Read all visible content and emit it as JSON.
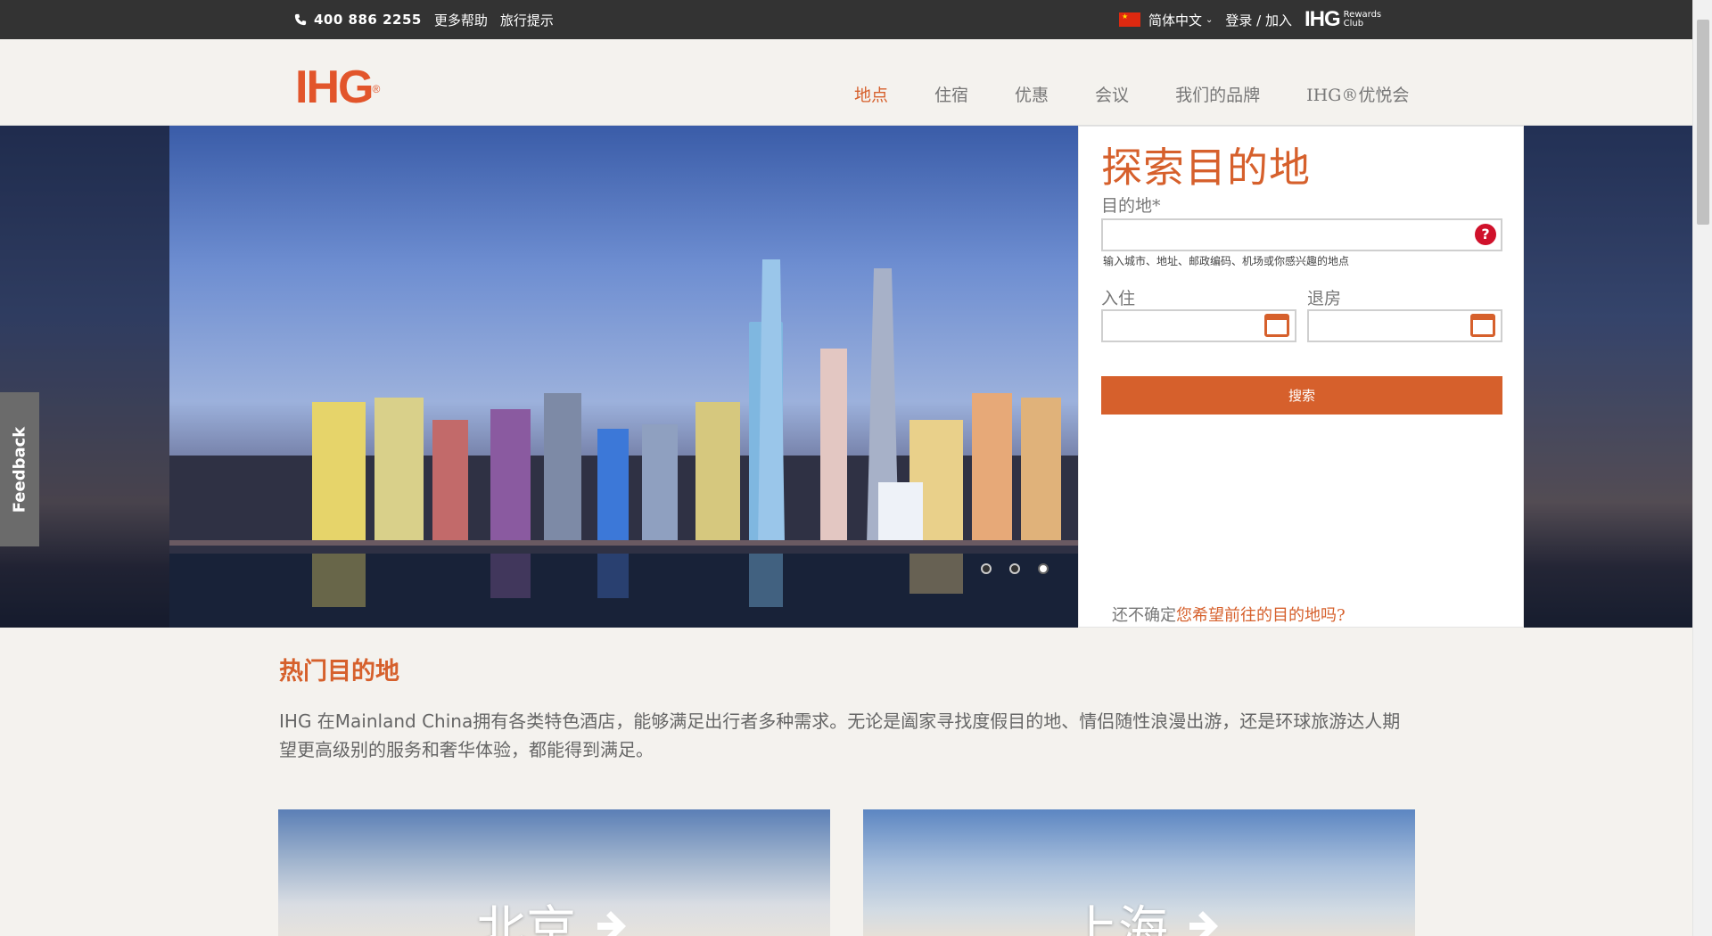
{
  "topbar": {
    "phone": "400 886 2255",
    "help_link": "更多帮助",
    "travel_tips": "旅行提示",
    "language": "简体中文",
    "login_join": "登录 / 加入",
    "rewards_mark": "IHG",
    "rewards_line1": "Rewards",
    "rewards_line2": "Club",
    "phone_icon": "phone-icon",
    "flag_icon": "china-flag-icon"
  },
  "header": {
    "logo": "IHG",
    "nav": [
      "地点",
      "住宿",
      "优惠",
      "会议",
      "我们的品牌",
      "IHG®优悦会"
    ],
    "active_nav": "地点"
  },
  "search_panel": {
    "title": "探索目的地",
    "destination_label": "目的地*",
    "destination_value": "",
    "destination_hint": "输入城市、地址、邮政编码、机场或你感兴趣的地点",
    "checkin_label": "入住",
    "checkout_label": "退房",
    "search_button": "搜索",
    "unsure_prefix": "还不确定",
    "unsure_link": "您希望前往的目的地吗?"
  },
  "carousel": {
    "slide_count": 3,
    "active_index": 2
  },
  "feedback": {
    "label": "Feedback"
  },
  "popular": {
    "title": "热门目的地",
    "intro": "IHG 在Mainland China拥有各类特色酒店，能够满足出行者多种需求。无论是阖家寻找度假目的地、情侣随性浪漫出游，还是环球旅游达人期望更高级别的服务和奢华体验，都能得到满足。",
    "cities": [
      "北京",
      "上海"
    ]
  },
  "colors": {
    "accent": "#d6602c",
    "topbar": "#333333",
    "background": "#f4f2ee",
    "help_red": "#d0112b"
  }
}
